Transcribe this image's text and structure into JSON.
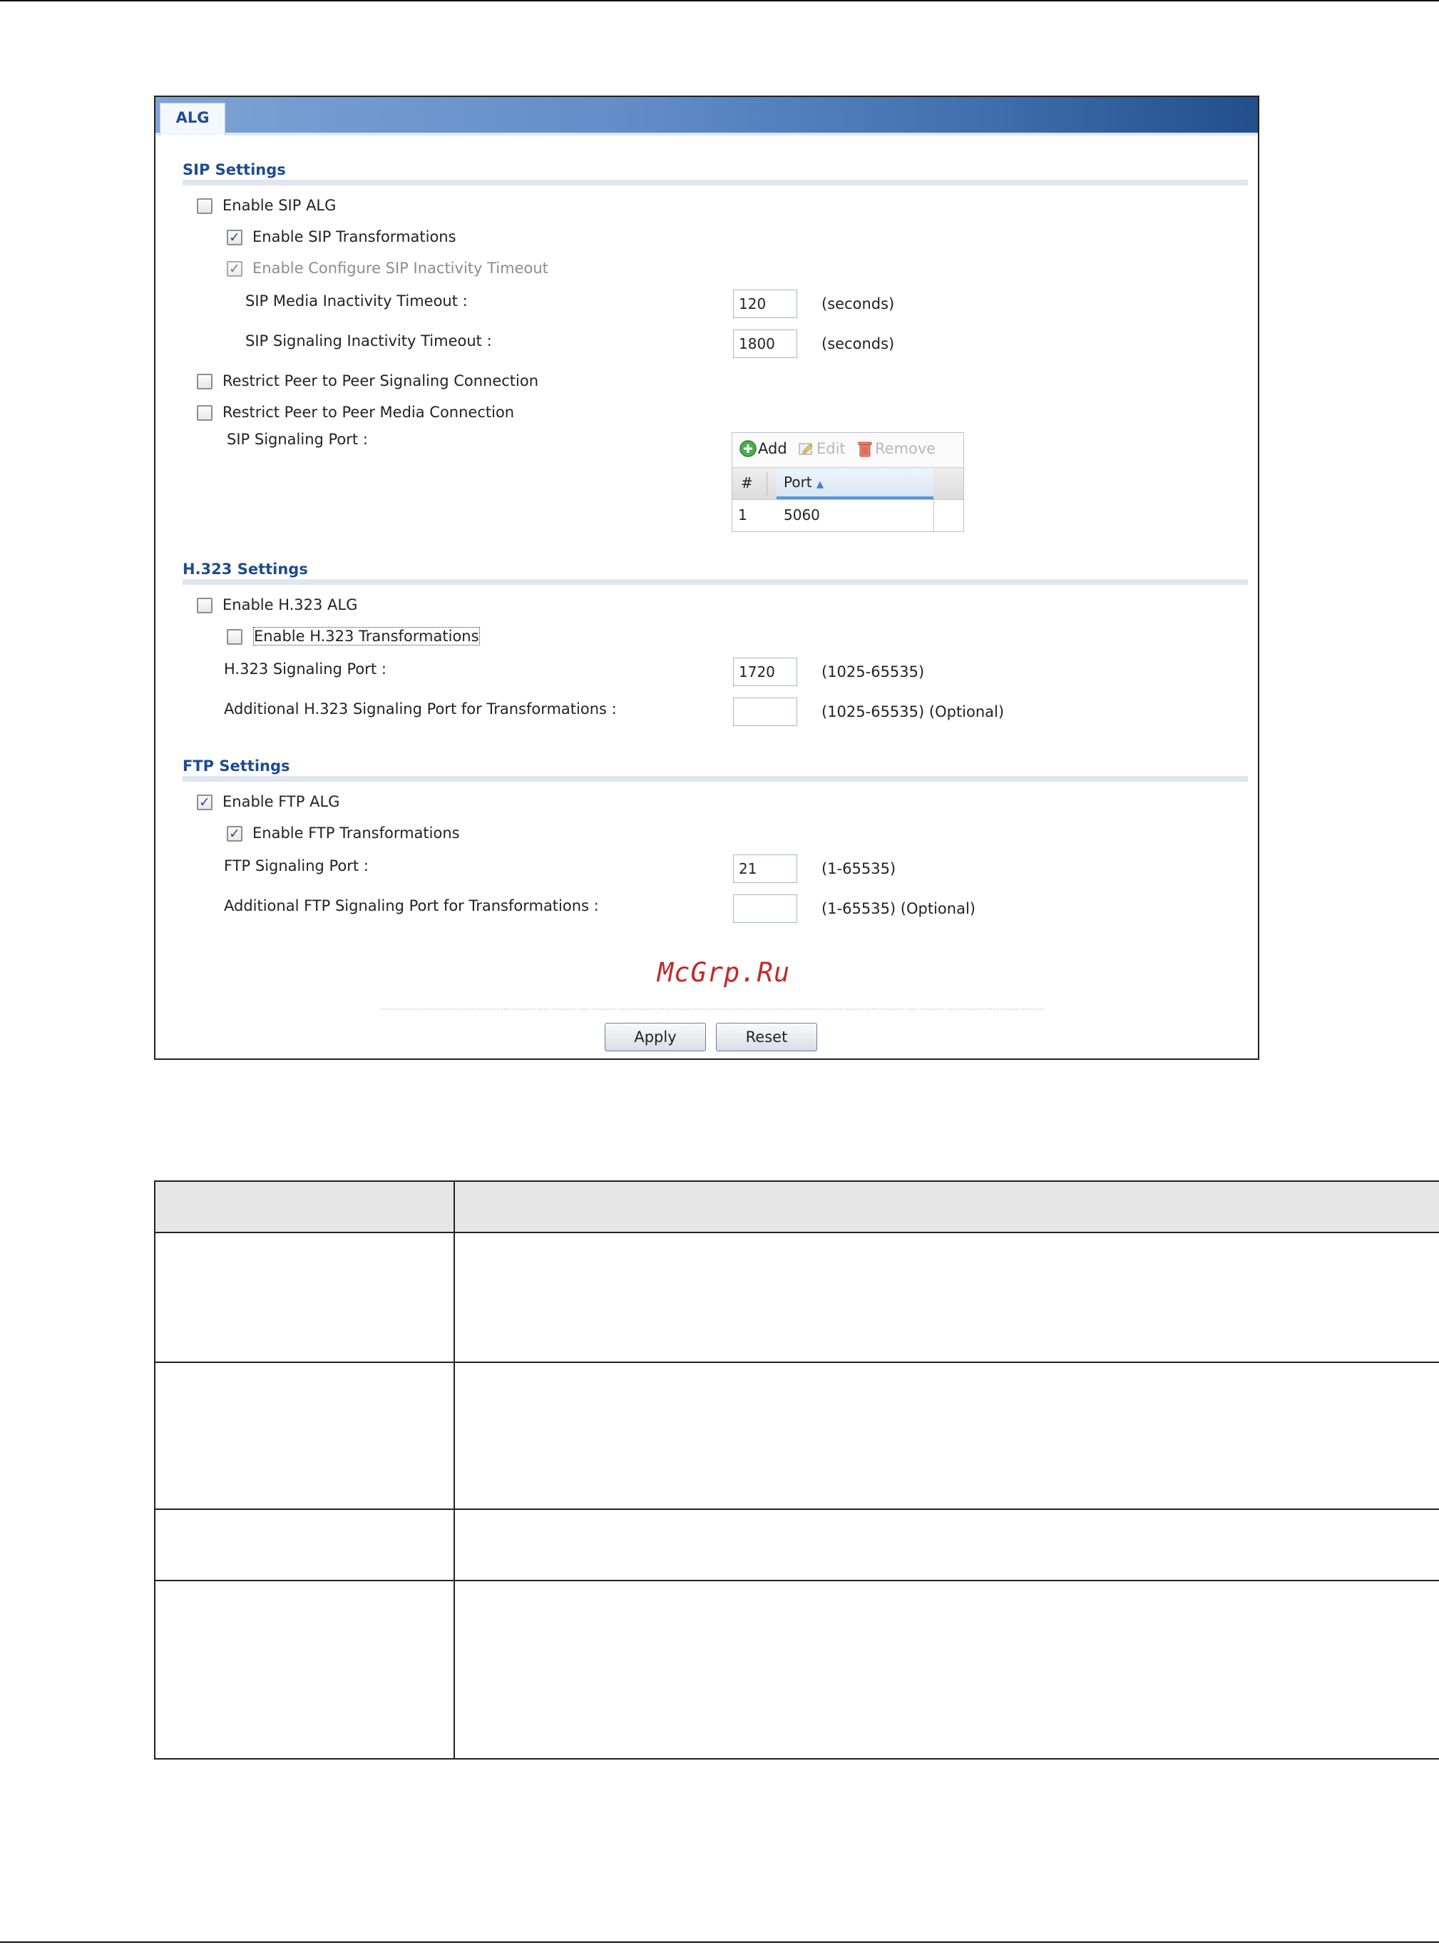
{
  "panel": {
    "tab_label": "ALG",
    "sip": {
      "title": "SIP Settings",
      "enable_alg": {
        "label": "Enable SIP ALG",
        "checked": false
      },
      "enable_transformations": {
        "label": "Enable SIP Transformations",
        "checked": true
      },
      "enable_inactivity_timeout": {
        "label": "Enable Configure SIP Inactivity Timeout",
        "checked": true
      },
      "media_timeout": {
        "label": "SIP Media Inactivity Timeout :",
        "value": "120",
        "unit": "(seconds)"
      },
      "signaling_timeout": {
        "label": "SIP Signaling Inactivity Timeout :",
        "value": "1800",
        "unit": "(seconds)"
      },
      "restrict_signaling": {
        "label": "Restrict Peer to Peer Signaling Connection",
        "checked": false
      },
      "restrict_media": {
        "label": "Restrict Peer to Peer Media Connection",
        "checked": false
      },
      "signaling_port_label": "SIP Signaling Port :",
      "port_table": {
        "add_label": "Add",
        "edit_label": "Edit",
        "remove_label": "Remove",
        "col_index": "#",
        "col_port": "Port",
        "sort_indicator": "▲",
        "rows": [
          {
            "index": "1",
            "port": "5060"
          }
        ]
      }
    },
    "h323": {
      "title": "H.323 Settings",
      "enable_alg": {
        "label": "Enable H.323 ALG",
        "checked": false
      },
      "enable_transformations": {
        "label": "Enable H.323 Transformations",
        "checked": false
      },
      "signaling_port": {
        "label": "H.323 Signaling Port :",
        "value": "1720",
        "range": "(1025-65535)"
      },
      "additional_port": {
        "label": "Additional H.323 Signaling Port for Transformations :",
        "value": "",
        "range": "(1025-65535) (Optional)"
      }
    },
    "ftp": {
      "title": "FTP Settings",
      "enable_alg": {
        "label": "Enable FTP ALG",
        "checked": true
      },
      "enable_transformations": {
        "label": "Enable FTP Transformations",
        "checked": true
      },
      "signaling_port": {
        "label": "FTP Signaling Port :",
        "value": "21",
        "range": "(1-65535)"
      },
      "additional_port": {
        "label": "Additional FTP Signaling Port for Transformations :",
        "value": "",
        "range": "(1-65535) (Optional)"
      }
    },
    "watermark": "McGrp.Ru",
    "apply_label": "Apply",
    "reset_label": "Reset"
  },
  "check_mark": "✓",
  "colors": {
    "section_title": "#1f4c8f",
    "banner_dark": "#224f8c",
    "watermark": "#c62828"
  }
}
